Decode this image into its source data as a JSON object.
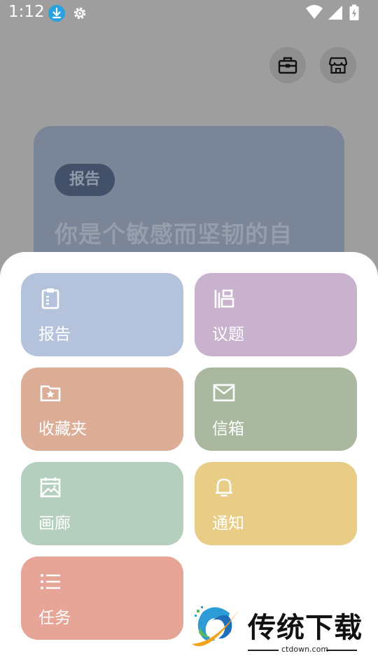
{
  "status_bar": {
    "time": "1:12",
    "icons": [
      "download-icon",
      "settings-icon",
      "wifi-icon",
      "signal-icon",
      "battery-charging-icon"
    ]
  },
  "header": {
    "buttons": [
      "briefcase-icon",
      "store-icon"
    ]
  },
  "report_card": {
    "tag": "报告",
    "headline": "你是个敏感而坚韧的自"
  },
  "menu": {
    "items": [
      {
        "label": "报告",
        "icon": "clipboard-icon",
        "color": "#b4c3db"
      },
      {
        "label": "议题",
        "icon": "topic-icon",
        "color": "#c8b2ce"
      },
      {
        "label": "收藏夹",
        "icon": "folder-star-icon",
        "color": "#dcae98"
      },
      {
        "label": "信箱",
        "icon": "mail-icon",
        "color": "#a9b89f"
      },
      {
        "label": "画廊",
        "icon": "gallery-icon",
        "color": "#b4cfbe"
      },
      {
        "label": "通知",
        "icon": "bell-icon",
        "color": "#e9cd86"
      },
      {
        "label": "任务",
        "icon": "list-icon",
        "color": "#e6a596"
      }
    ]
  },
  "watermark": {
    "text": "传统下载",
    "url": "ctdown.com"
  }
}
